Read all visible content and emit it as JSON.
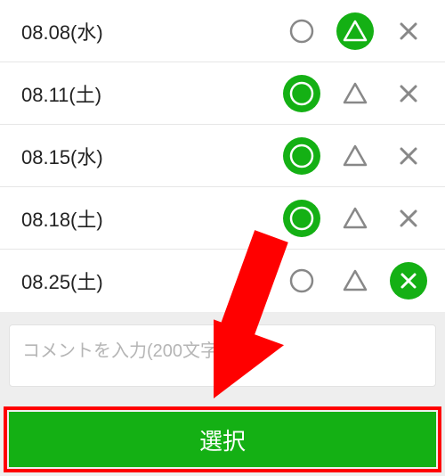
{
  "colors": {
    "accent": "#14b014",
    "highlight": "#ff0000"
  },
  "rows": [
    {
      "date": "08.08(水)",
      "selected": "triangle"
    },
    {
      "date": "08.11(土)",
      "selected": "circle"
    },
    {
      "date": "08.15(水)",
      "selected": "circle"
    },
    {
      "date": "08.18(土)",
      "selected": "circle"
    },
    {
      "date": "08.25(土)",
      "selected": "cross"
    }
  ],
  "comment": {
    "value": "",
    "placeholder": "コメントを入力(200文字以内)"
  },
  "submit": {
    "label": "選択"
  },
  "annotation": {
    "arrow_points_to": "submit-button",
    "highlight": "submit-button"
  }
}
